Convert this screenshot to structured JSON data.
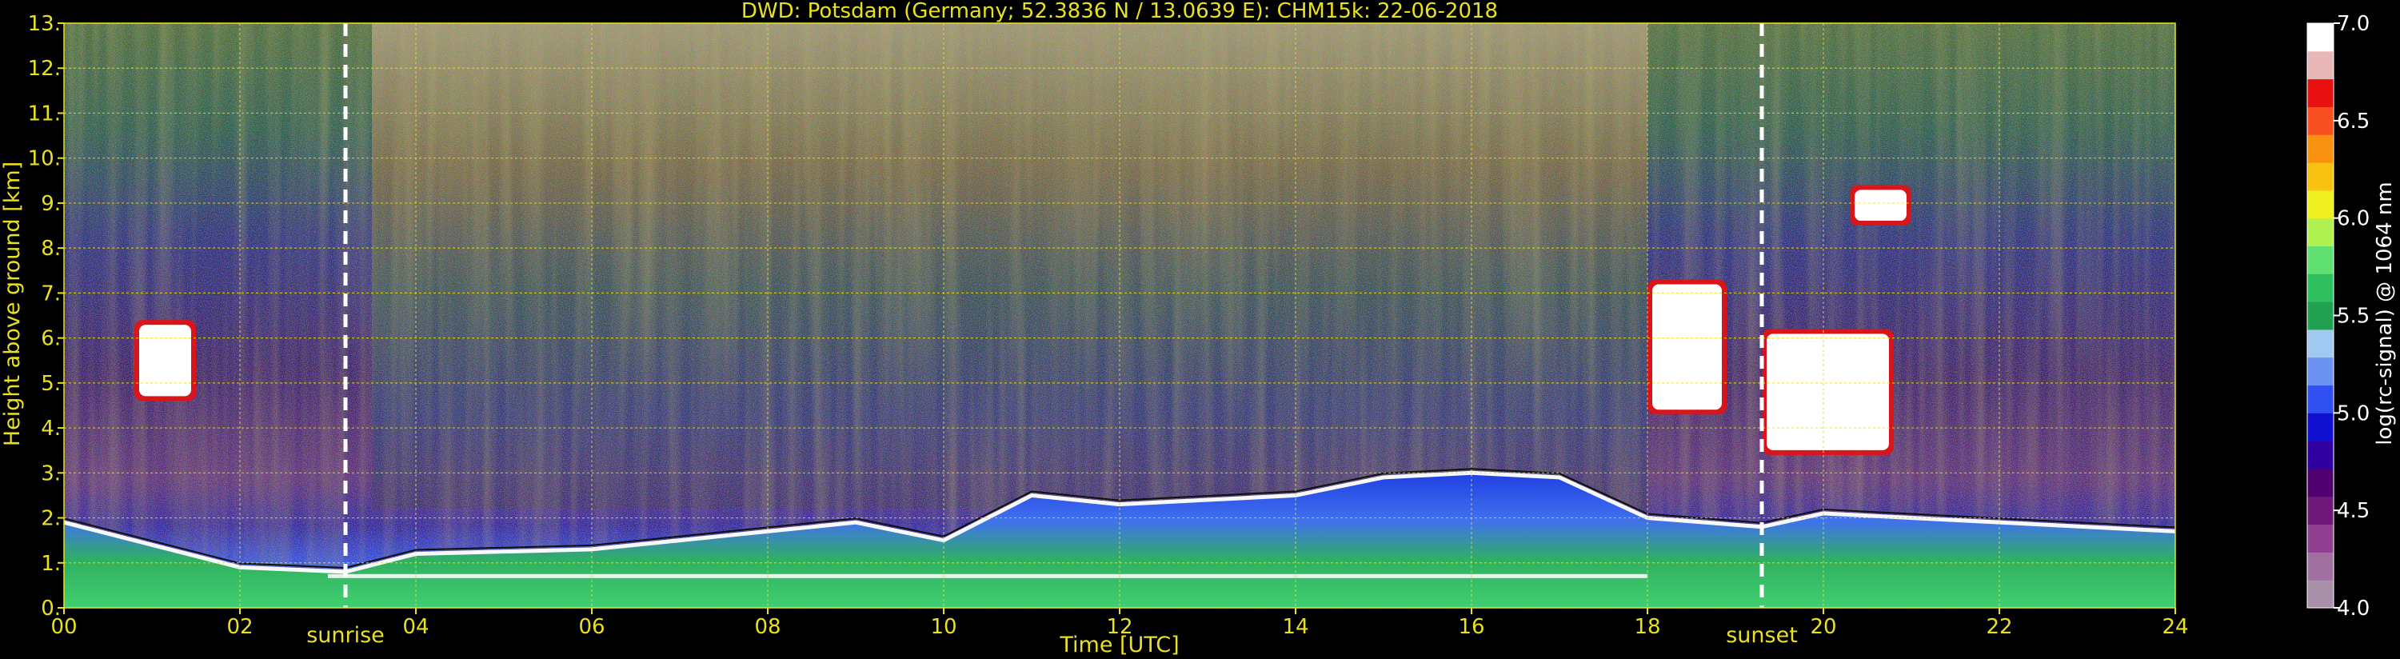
{
  "chart_data": {
    "type": "heatmap",
    "title": "DWD: Potsdam (Germany; 52.3836 N / 13.0639 E):    CHM15k: 22-06-2018",
    "xlabel": "Time [UTC]",
    "ylabel": "Height above ground [km]",
    "xlim": [
      0,
      24
    ],
    "ylim": [
      0.0,
      13.0
    ],
    "x_ticks": [
      "00",
      "02",
      "04",
      "06",
      "08",
      "10",
      "12",
      "14",
      "16",
      "18",
      "20",
      "22",
      "24"
    ],
    "x_tick_values": [
      0,
      2,
      4,
      6,
      8,
      10,
      12,
      14,
      16,
      18,
      20,
      22,
      24
    ],
    "y_ticks": [
      "0.",
      "1.",
      "2.",
      "3.",
      "4.",
      "5.",
      "6.",
      "7.",
      "8.",
      "9.",
      "10.",
      "11.",
      "12.",
      "13."
    ],
    "y_tick_values": [
      0,
      1,
      2,
      3,
      4,
      5,
      6,
      7,
      8,
      9,
      10,
      11,
      12,
      13
    ],
    "grid": true,
    "colorbar": {
      "label": "log(rc-signal) @ 1064 nm",
      "range": [
        4.0,
        7.0
      ],
      "ticks": [
        "4.0",
        "4.5",
        "5.0",
        "5.5",
        "6.0",
        "6.5",
        "7.0"
      ],
      "tick_values": [
        4.0,
        4.5,
        5.0,
        5.5,
        6.0,
        6.5,
        7.0
      ],
      "colors": [
        "#a890a8",
        "#a070a0",
        "#904090",
        "#701878",
        "#500070",
        "#3000a0",
        "#1010d0",
        "#3050f0",
        "#6a90f0",
        "#a0c8f0",
        "#20a050",
        "#30c060",
        "#60e070",
        "#b0f050",
        "#f0f020",
        "#f8c010",
        "#f89010",
        "#f85020",
        "#e81010",
        "#e8b8b8",
        "#ffffff"
      ]
    },
    "annotations": [
      {
        "text": "sunrise",
        "x": 3.2
      },
      {
        "text": "sunset",
        "x": 19.3
      }
    ],
    "features": {
      "boundary_layer_top_km": [
        [
          0,
          1.9
        ],
        [
          2,
          0.9
        ],
        [
          3.2,
          0.8
        ],
        [
          4,
          1.2
        ],
        [
          6,
          1.3
        ],
        [
          8,
          1.7
        ],
        [
          9,
          1.9
        ],
        [
          10,
          1.5
        ],
        [
          11,
          2.5
        ],
        [
          12,
          2.3
        ],
        [
          14,
          2.5
        ],
        [
          15,
          2.9
        ],
        [
          16,
          3.0
        ],
        [
          17,
          2.9
        ],
        [
          18,
          2.0
        ],
        [
          19.3,
          1.8
        ],
        [
          20,
          2.1
        ],
        [
          22,
          1.9
        ],
        [
          24,
          1.7
        ]
      ],
      "cloud_layers": [
        {
          "x_start": 18.0,
          "x_end": 18.9,
          "base_km": 4.3,
          "top_km": 7.3
        },
        {
          "x_start": 19.3,
          "x_end": 20.8,
          "base_km": 3.4,
          "top_km": 6.2
        },
        {
          "x_start": 0.8,
          "x_end": 1.5,
          "base_km": 4.6,
          "top_km": 6.4
        },
        {
          "x_start": 20.3,
          "x_end": 21.0,
          "base_km": 8.5,
          "top_km": 9.4
        }
      ]
    }
  }
}
